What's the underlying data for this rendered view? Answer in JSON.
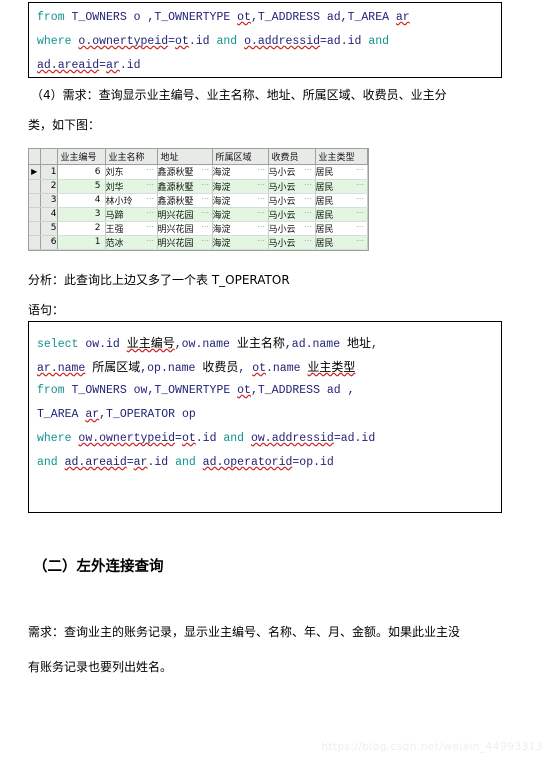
{
  "code_top": {
    "lines": [
      [
        {
          "t": "from ",
          "c": "kw"
        },
        {
          "t": "T_OWNERS o ,T_OWNERTYPE ",
          "c": "id"
        },
        {
          "t": "ot",
          "c": "id sq"
        },
        {
          "t": ",T_ADDRESS ad,T_AREA  ",
          "c": "id"
        },
        {
          "t": "ar",
          "c": "id sq"
        }
      ],
      [
        {
          "t": "where ",
          "c": "kw"
        },
        {
          "t": "  ",
          "c": "id"
        },
        {
          "t": "o.ownertypeid",
          "c": "id sq"
        },
        {
          "t": "=",
          "c": "id"
        },
        {
          "t": "ot",
          "c": "id sq"
        },
        {
          "t": ".id   ",
          "c": "id"
        },
        {
          "t": "and ",
          "c": "kw"
        },
        {
          "t": "  ",
          "c": "id"
        },
        {
          "t": "o.addressid",
          "c": "id sq"
        },
        {
          "t": "=ad.id   ",
          "c": "id"
        },
        {
          "t": "and",
          "c": "kw"
        }
      ],
      [
        {
          "t": "ad.areaid",
          "c": "id sq"
        },
        {
          "t": "=",
          "c": "id"
        },
        {
          "t": "ar",
          "c": "id sq"
        },
        {
          "t": ".id",
          "c": "id"
        }
      ]
    ]
  },
  "para_requirement": {
    "line1": "（4）需求：查询显示业主编号、业主名称、地址、所属区域、收费员、业主分",
    "line2": "类，如下图："
  },
  "grid": {
    "columns": [
      "业主编号",
      "业主名称",
      "地址",
      "所属区域",
      "收费员",
      "业主类型"
    ],
    "rows": [
      {
        "n": "1",
        "marker": "▶",
        "cells": [
          "6",
          "刘东",
          "鑫源秋墅",
          "海淀",
          "马小云",
          "居民"
        ]
      },
      {
        "n": "2",
        "marker": "",
        "cells": [
          "5",
          "刘华",
          "鑫源秋墅",
          "海淀",
          "马小云",
          "居民"
        ]
      },
      {
        "n": "3",
        "marker": "",
        "cells": [
          "4",
          "林小玲",
          "鑫源秋墅",
          "海淀",
          "马小云",
          "居民"
        ]
      },
      {
        "n": "4",
        "marker": "",
        "cells": [
          "3",
          "马蹄",
          "明兴花园",
          "海淀",
          "马小云",
          "居民"
        ]
      },
      {
        "n": "5",
        "marker": "",
        "cells": [
          "2",
          "王强",
          "明兴花园",
          "海淀",
          "马小云",
          "居民"
        ]
      },
      {
        "n": "6",
        "marker": "",
        "cells": [
          "1",
          "范冰",
          "明兴花园",
          "海淀",
          "马小云",
          "居民"
        ]
      }
    ],
    "ellipsis": "⋯"
  },
  "para_analysis": "分析：此查询比上边又多了一个表 T_OPERATOR",
  "para_statement": "语句：",
  "code_bottom": {
    "lines": [
      [
        {
          "t": "select ",
          "c": "kw"
        },
        {
          "t": "ow.id ",
          "c": "id"
        },
        {
          "t": "业主编号",
          "c": "cn id sq"
        },
        {
          "t": ",ow.name ",
          "c": "id"
        },
        {
          "t": "业主名称",
          "c": "cn id"
        },
        {
          "t": ",ad.name ",
          "c": "id"
        },
        {
          "t": "地址",
          "c": "cn id"
        },
        {
          "t": ",",
          "c": "id"
        }
      ],
      [
        {
          "t": "ar.name",
          "c": "id sq"
        },
        {
          "t": " ",
          "c": "id"
        },
        {
          "t": "所属区域",
          "c": "cn id"
        },
        {
          "t": ",op.name ",
          "c": "id"
        },
        {
          "t": "收费员",
          "c": "cn id"
        },
        {
          "t": ", ",
          "c": "id"
        },
        {
          "t": "ot",
          "c": "id sq"
        },
        {
          "t": ".name ",
          "c": "id"
        },
        {
          "t": "业主类型",
          "c": "cn id sq"
        }
      ],
      [
        {
          "t": "from ",
          "c": "kw"
        },
        {
          "t": "T_OWNERS ow,T_OWNERTYPE ",
          "c": "id"
        },
        {
          "t": "ot",
          "c": "id sq"
        },
        {
          "t": ",T_ADDRESS ad ,",
          "c": "id"
        }
      ],
      [
        {
          "t": "T_AREA ",
          "c": "id"
        },
        {
          "t": "ar",
          "c": "id sq"
        },
        {
          "t": ",T_OPERATOR op",
          "c": "id"
        }
      ],
      [
        {
          "t": "where ",
          "c": "kw"
        },
        {
          "t": "ow.ownertypeid",
          "c": "id sq"
        },
        {
          "t": "=",
          "c": "id"
        },
        {
          "t": "ot",
          "c": "id sq"
        },
        {
          "t": ".id ",
          "c": "id"
        },
        {
          "t": "and ",
          "c": "kw"
        },
        {
          "t": "ow.addressid",
          "c": "id sq"
        },
        {
          "t": "=ad.id",
          "c": "id"
        }
      ],
      [
        {
          "t": "and ",
          "c": "kw"
        },
        {
          "t": "ad.areaid",
          "c": "id sq"
        },
        {
          "t": "=",
          "c": "id"
        },
        {
          "t": "ar",
          "c": "id sq"
        },
        {
          "t": ".id ",
          "c": "id"
        },
        {
          "t": "and ",
          "c": "kw"
        },
        {
          "t": "ad.operatorid",
          "c": "id sq"
        },
        {
          "t": "=op.id",
          "c": "id"
        }
      ]
    ]
  },
  "section_heading": "（二）左外连接查询",
  "para_need": {
    "line1": "需求：查询业主的账务记录，显示业主编号、名称、年、月、金额。如果此业主没",
    "line2": "有账务记录也要列出姓名。"
  },
  "watermark": "https://blog.csdn.net/weixin_44993313"
}
